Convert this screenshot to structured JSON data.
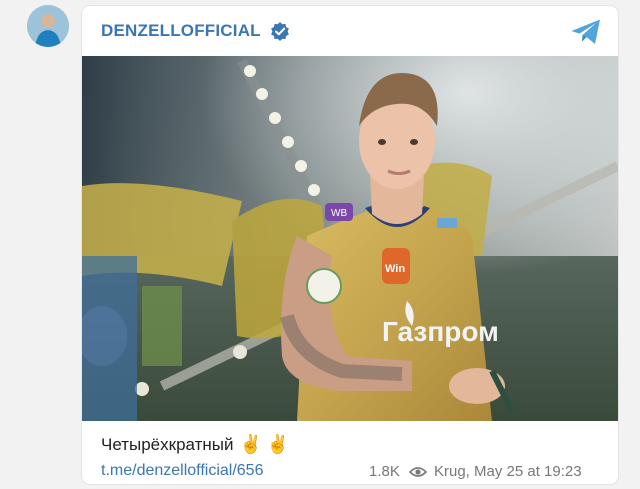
{
  "post": {
    "channel_name": "DENZELLOFFICIAL",
    "caption_text": "Четырёхкратный",
    "caption_emoji": "✌️ ✌️",
    "link_text": "t.me/denzellofficial/656",
    "views": "1.8K",
    "author_date": "Krug, May 25 at 19:23",
    "jersey_sponsor": "Газпром",
    "sleeve_badge": "WB",
    "chest_badge": "Win"
  },
  "icons": {
    "avatar": "avatar",
    "verified": "verified-check-icon",
    "telegram": "telegram-plane-icon",
    "views": "eye-icon"
  },
  "colors": {
    "accent": "#3a76b3",
    "jersey_gold": "#c7a84e",
    "jersey_navy": "#2d3f77"
  }
}
